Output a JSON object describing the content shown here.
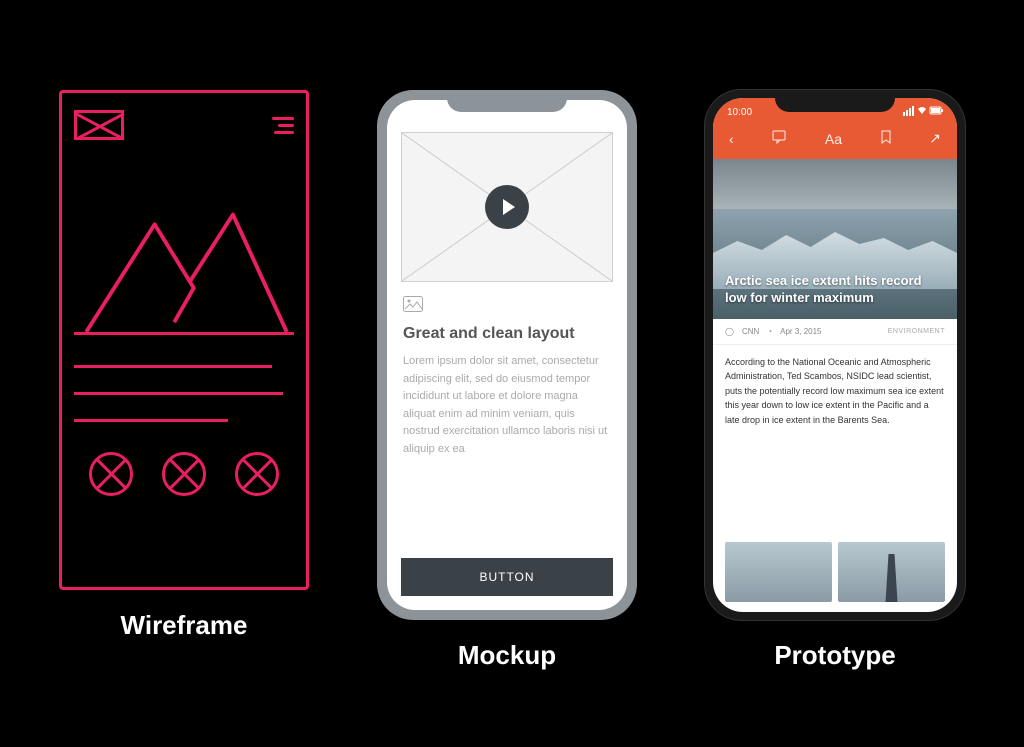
{
  "labels": {
    "wireframe": "Wireframe",
    "mockup": "Mockup",
    "prototype": "Prototype"
  },
  "mockup": {
    "title": "Great and clean layout",
    "body": "Lorem ipsum dolor sit amet, consectetur adipiscing elit, sed do eiusmod tempor incididunt ut labore et dolore magna aliquat enim ad minim veniam, quis nostrud exercitation ullamco laboris nisi ut aliquip ex ea",
    "button": "BUTTON"
  },
  "prototype": {
    "status_time": "10:00",
    "toolbar": {
      "font": "Aa"
    },
    "hero_title": "Arctic sea ice extent hits record low for winter maximum",
    "meta": {
      "source": "CNN",
      "date": "Apr 3, 2015",
      "category": "ENVIRONMENT"
    },
    "article": "According to the National Oceanic and Atmospheric Administration, Ted Scambos, NSIDC lead scientist, puts the potentially record low maximum sea ice extent this year down to low ice extent in the Pacific and a late drop in ice extent in the Barents Sea."
  }
}
